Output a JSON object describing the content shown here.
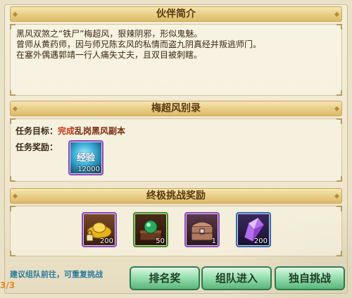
{
  "sections": {
    "partner_intro": {
      "title": "伙伴简介",
      "lines": [
        "黑风双煞之“铁尸”梅超风，狠辣阴邪，形似鬼魅。",
        "曾师从黄药师，因与师兄陈玄风的私情而盗九阴真经并叛逃师门。",
        "在塞外偶遇郭靖一行人痛失丈夫，且双目被刺瞎。"
      ]
    },
    "record": {
      "title": "梅超风别录",
      "task_goal_label": "任务目标：",
      "task_status": "完成",
      "task_target": "乱岗黑风副本",
      "task_reward_label": "任务奖励：",
      "reward_item": {
        "icon": "experience-orb-icon",
        "label": "经验",
        "qty": "12000",
        "border_color": "#8a4ab8"
      }
    },
    "ultimate": {
      "title": "终极挑战奖励",
      "items": [
        {
          "icon": "gold-ingot-locked-icon",
          "qty": "200",
          "border_color": "#8a4ab8"
        },
        {
          "icon": "jade-orb-box-icon",
          "qty": "50",
          "border_color": "#4a8a2a"
        },
        {
          "icon": "treasure-chest-icon",
          "qty": "1",
          "border_color": "#8a4ab8"
        },
        {
          "icon": "purple-crystal-icon",
          "qty": "200",
          "border_color": "#3a6ab0"
        }
      ]
    }
  },
  "footer": {
    "hint": "建议组队前往，可重复挑战",
    "page_counter": "3/3",
    "buttons": {
      "rank": "排名奖",
      "team": "组队进入",
      "solo": "独自挑战"
    }
  },
  "colors": {
    "accent_red": "#c03a14",
    "hint_blue": "#2a7a9a",
    "button_green": "#5ab57c"
  }
}
